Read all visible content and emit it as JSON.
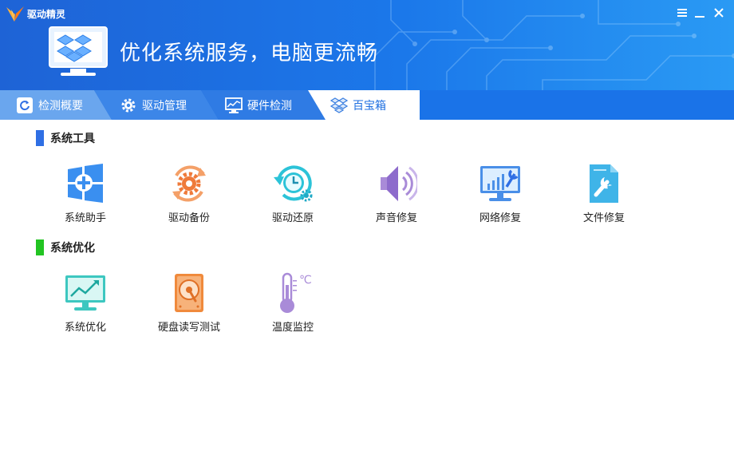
{
  "app": {
    "title": "驱动精灵"
  },
  "header": {
    "slogan": "优化系统服务，电脑更流畅"
  },
  "tabs": [
    {
      "label": "检测概要",
      "icon": "refresh-icon"
    },
    {
      "label": "驱动管理",
      "icon": "gear-icon"
    },
    {
      "label": "硬件检测",
      "icon": "monitor-chart-icon"
    },
    {
      "label": "百宝箱",
      "icon": "toolbox-icon",
      "active": true
    }
  ],
  "sections": [
    {
      "title": "系统工具",
      "accent": "#2f6fe4",
      "items": [
        {
          "label": "系统助手",
          "icon": "windows-plus-icon"
        },
        {
          "label": "驱动备份",
          "icon": "backup-gear-icon"
        },
        {
          "label": "驱动还原",
          "icon": "restore-clock-icon"
        },
        {
          "label": "声音修复",
          "icon": "speaker-icon"
        },
        {
          "label": "网络修复",
          "icon": "network-repair-icon"
        },
        {
          "label": "文件修复",
          "icon": "file-repair-icon"
        }
      ]
    },
    {
      "title": "系统优化",
      "accent": "#22c422",
      "items": [
        {
          "label": "系统优化",
          "icon": "monitor-trend-icon"
        },
        {
          "label": "硬盘读写测试",
          "icon": "harddisk-icon"
        },
        {
          "label": "温度监控",
          "icon": "thermometer-icon"
        }
      ]
    }
  ],
  "colors": {
    "header_blue": "#1e63d6",
    "tab_active_bg": "#ffffff",
    "tab_active_text": "#1f6fe0"
  }
}
